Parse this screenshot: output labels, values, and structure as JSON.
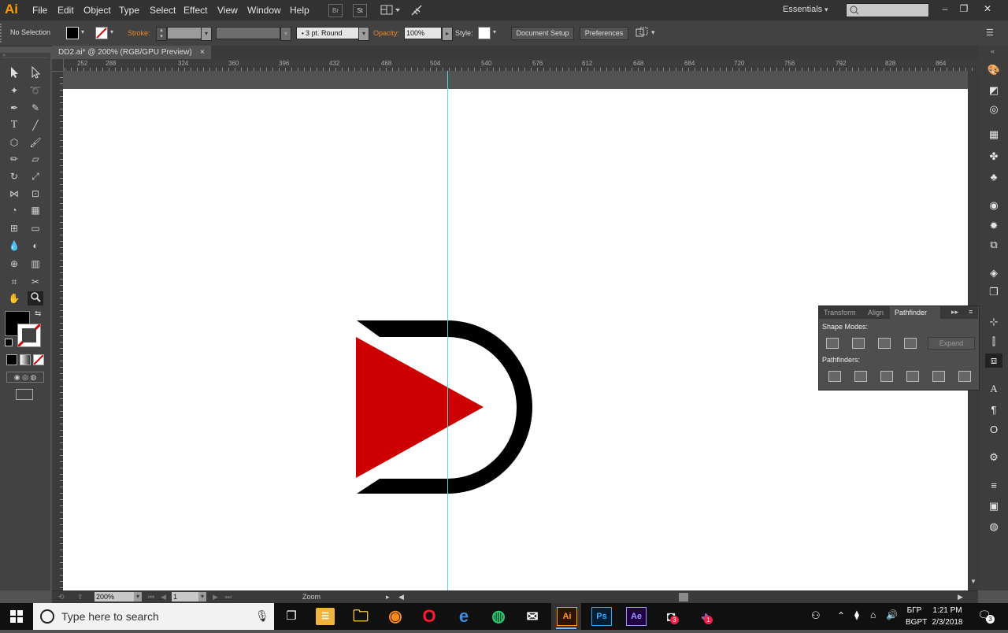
{
  "app": {
    "logo": "Ai"
  },
  "menu": [
    "File",
    "Edit",
    "Object",
    "Type",
    "Select",
    "Effect",
    "View",
    "Window",
    "Help"
  ],
  "menubar": {
    "bridge_label": "Br",
    "stock_label": "St",
    "workspace": "Essentials"
  },
  "control": {
    "selection_label": "No Selection",
    "stroke_label": "Stroke:",
    "brush_label": "3 pt. Round",
    "opacity_label": "Opacity:",
    "opacity_value": "100%",
    "style_label": "Style:",
    "doc_setup": "Document Setup",
    "preferences": "Preferences"
  },
  "document": {
    "tab_title": "DD2.ai* @ 200% (RGB/GPU Preview)"
  },
  "ruler": {
    "top_ticks": [
      "252",
      "288",
      "324",
      "360",
      "396",
      "432",
      "468",
      "504",
      "540",
      "576",
      "612",
      "648",
      "684",
      "720",
      "756",
      "792",
      "828",
      "864"
    ]
  },
  "pathfinder": {
    "tabs": [
      "Transform",
      "Align",
      "Pathfinder"
    ],
    "active_tab": "Pathfinder",
    "shape_modes_label": "Shape Modes:",
    "pathfinders_label": "Pathfinders:",
    "expand_label": "Expand"
  },
  "status": {
    "zoom": "200%",
    "page": "1",
    "tool_label": "Zoom"
  },
  "taskbar": {
    "search_placeholder": "Type here to search",
    "apps": [
      "Ai",
      "Ps",
      "Ae"
    ],
    "lang1": "БГР",
    "lang2": "BGPT",
    "time": "1:21 PM",
    "date": "2/3/2018",
    "notif_count": "3",
    "badge_a": "3",
    "badge_b": "1"
  },
  "colors": {
    "accent": "#ff9a00",
    "logo_red": "#cc0000",
    "guide": "#5fd3d8"
  }
}
